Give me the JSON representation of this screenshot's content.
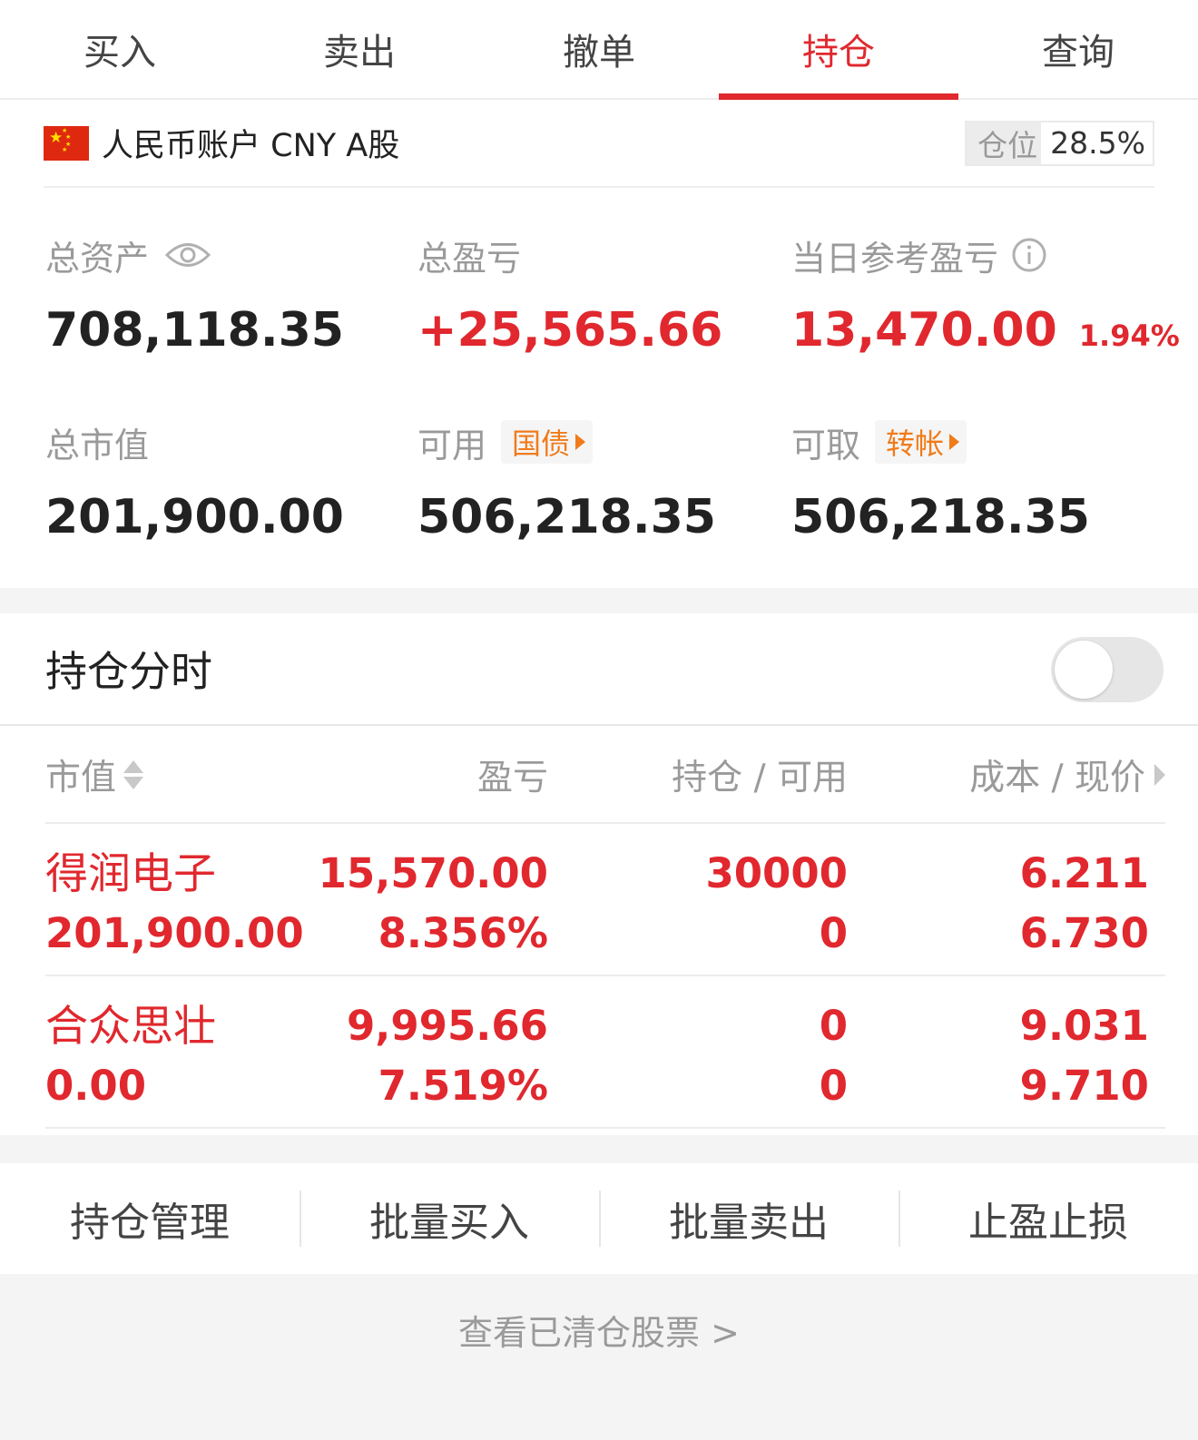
{
  "tabs": [
    {
      "label": "买入",
      "active": false
    },
    {
      "label": "卖出",
      "active": false
    },
    {
      "label": "撤单",
      "active": false
    },
    {
      "label": "持仓",
      "active": true
    },
    {
      "label": "查询",
      "active": false
    }
  ],
  "account": {
    "name": "人民币账户 CNY A股",
    "position_label": "仓位",
    "position_value": "28.5%",
    "total_assets_label": "总资产",
    "total_assets": "708,118.35",
    "total_pl_label": "总盈亏",
    "total_pl": "+25,565.66",
    "daily_pl_label": "当日参考盈亏",
    "daily_pl": "13,470.00",
    "daily_pl_pct": "1.94%",
    "market_value_label": "总市值",
    "market_value": "201,900.00",
    "available_label": "可用",
    "available_chip": "国债",
    "available": "506,218.35",
    "withdrawable_label": "可取",
    "withdrawable_chip": "转帐",
    "withdrawable": "506,218.35"
  },
  "holdings": {
    "title": "持仓分时",
    "toggle_on": false,
    "columns": {
      "market_value": "市值",
      "pl": "盈亏",
      "position": "持仓 / 可用",
      "cost_price": "成本 / 现价"
    },
    "rows": [
      {
        "name": "得润电子",
        "market_value": "201,900.00",
        "pl": "15,570.00",
        "pl_pct": "8.356%",
        "position": "30000",
        "available": "0",
        "cost": "6.211",
        "price": "6.730"
      },
      {
        "name": "合众思壮",
        "market_value": "0.00",
        "pl": "9,995.66",
        "pl_pct": "7.519%",
        "position": "0",
        "available": "0",
        "cost": "9.031",
        "price": "9.710"
      }
    ]
  },
  "actions": [
    "持仓管理",
    "批量买入",
    "批量卖出",
    "止盈止损"
  ],
  "cleared_link": "查看已清仓股票 >",
  "colors": {
    "accent_red": "#e0282e",
    "chip_orange": "#f07b1a",
    "label_gray": "#9a9a9a"
  }
}
